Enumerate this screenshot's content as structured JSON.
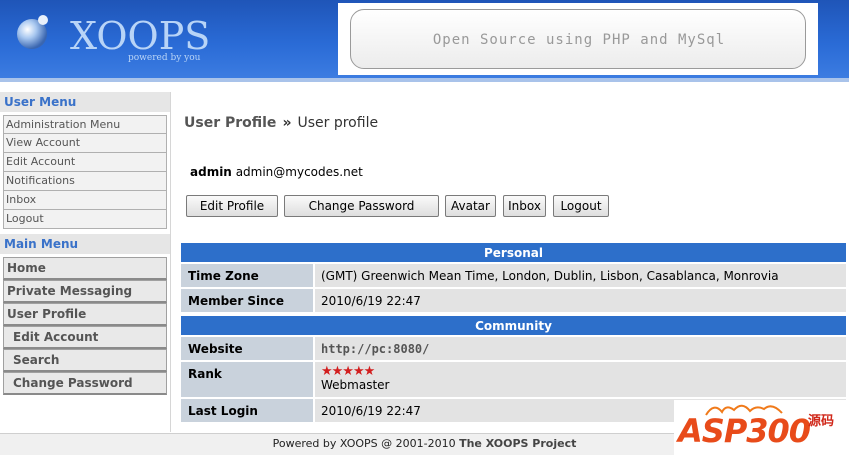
{
  "header": {
    "logo_text": "XOOPS",
    "logo_tagline": "powered by you",
    "banner_text": "Open Source using PHP and MySql"
  },
  "user_menu": {
    "title": "User Menu",
    "items": [
      {
        "label": "Administration Menu"
      },
      {
        "label": "View Account"
      },
      {
        "label": "Edit Account"
      },
      {
        "label": "Notifications"
      },
      {
        "label": "Inbox"
      },
      {
        "label": "Logout"
      }
    ]
  },
  "main_menu": {
    "title": "Main Menu",
    "items": [
      {
        "label": "Home"
      },
      {
        "label": "Private Messaging"
      },
      {
        "label": "User Profile"
      },
      {
        "label": "Edit Account"
      },
      {
        "label": "Search"
      },
      {
        "label": "Change Password"
      }
    ]
  },
  "breadcrumb": {
    "home": "User Profile",
    "separator": "»",
    "current": "User profile"
  },
  "user": {
    "name": "admin",
    "email": "admin@mycodes.net"
  },
  "buttons": {
    "edit_profile": "Edit Profile",
    "change_password": "Change Password",
    "avatar": "Avatar",
    "inbox": "Inbox",
    "logout": "Logout"
  },
  "profile": {
    "personal_title": "Personal",
    "timezone_label": "Time Zone",
    "timezone_value": "(GMT) Greenwich Mean Time, London, Dublin, Lisbon, Casablanca, Monrovia",
    "member_since_label": "Member Since",
    "member_since_value": "2010/6/19 22:47",
    "community_title": "Community",
    "website_label": "Website",
    "website_value": "http://pc:8080/",
    "rank_label": "Rank",
    "rank_stars": "★★★★★",
    "rank_value": "Webmaster",
    "last_login_label": "Last Login",
    "last_login_value": "2010/6/19 22:47"
  },
  "footer": {
    "prefix": "Powered by XOOPS @ 2001-2010",
    "project": "The XOOPS Project"
  },
  "watermark": {
    "text": "ASP300",
    "side": "源码"
  },
  "colors": {
    "header_blue": "#2a6bd6",
    "section_blue": "#2d6fca",
    "menu_title_blue": "#3a72c9",
    "star_red": "#d21e1e"
  }
}
